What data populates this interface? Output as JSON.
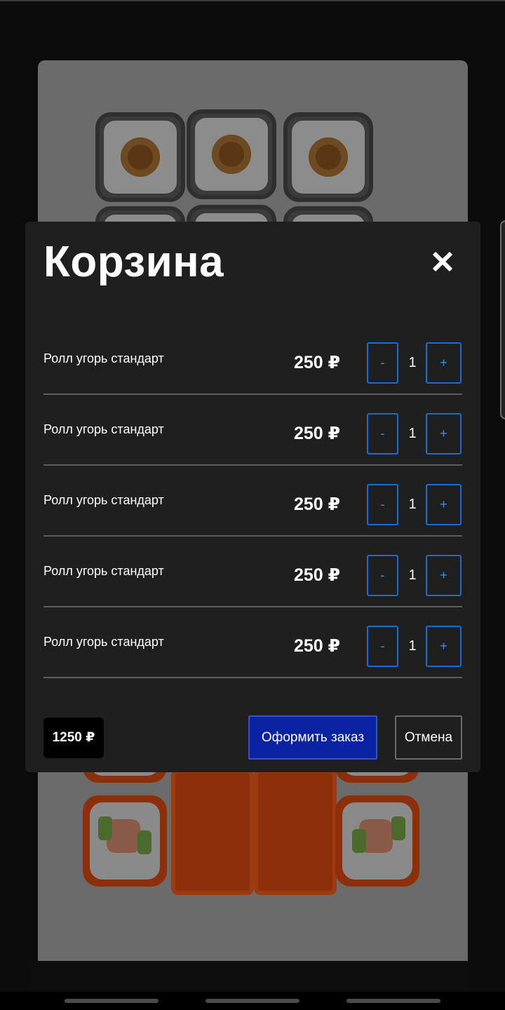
{
  "cart": {
    "title": "Корзина",
    "items": [
      {
        "name": "Ролл угорь стандарт",
        "price": "250 ₽",
        "minus": "-",
        "qty": "1",
        "plus": "+"
      },
      {
        "name": "Ролл угорь стандарт",
        "price": "250 ₽",
        "minus": "-",
        "qty": "1",
        "plus": "+"
      },
      {
        "name": "Ролл угорь стандарт",
        "price": "250 ₽",
        "minus": "-",
        "qty": "1",
        "plus": "+"
      },
      {
        "name": "Ролл угорь стандарт",
        "price": "250 ₽",
        "minus": "-",
        "qty": "1",
        "plus": "+"
      },
      {
        "name": "Ролл угорь стандарт",
        "price": "250 ₽",
        "minus": "-",
        "qty": "1",
        "plus": "+"
      }
    ],
    "total": "1250 ₽",
    "order_label": "Оформить заказ",
    "cancel_label": "Отмена"
  },
  "icons": {
    "close": "close-icon"
  },
  "colors": {
    "modal_bg": "#1f1f1f",
    "accent_blue": "#0a23a3",
    "stepper_border": "#1a6dd0"
  }
}
